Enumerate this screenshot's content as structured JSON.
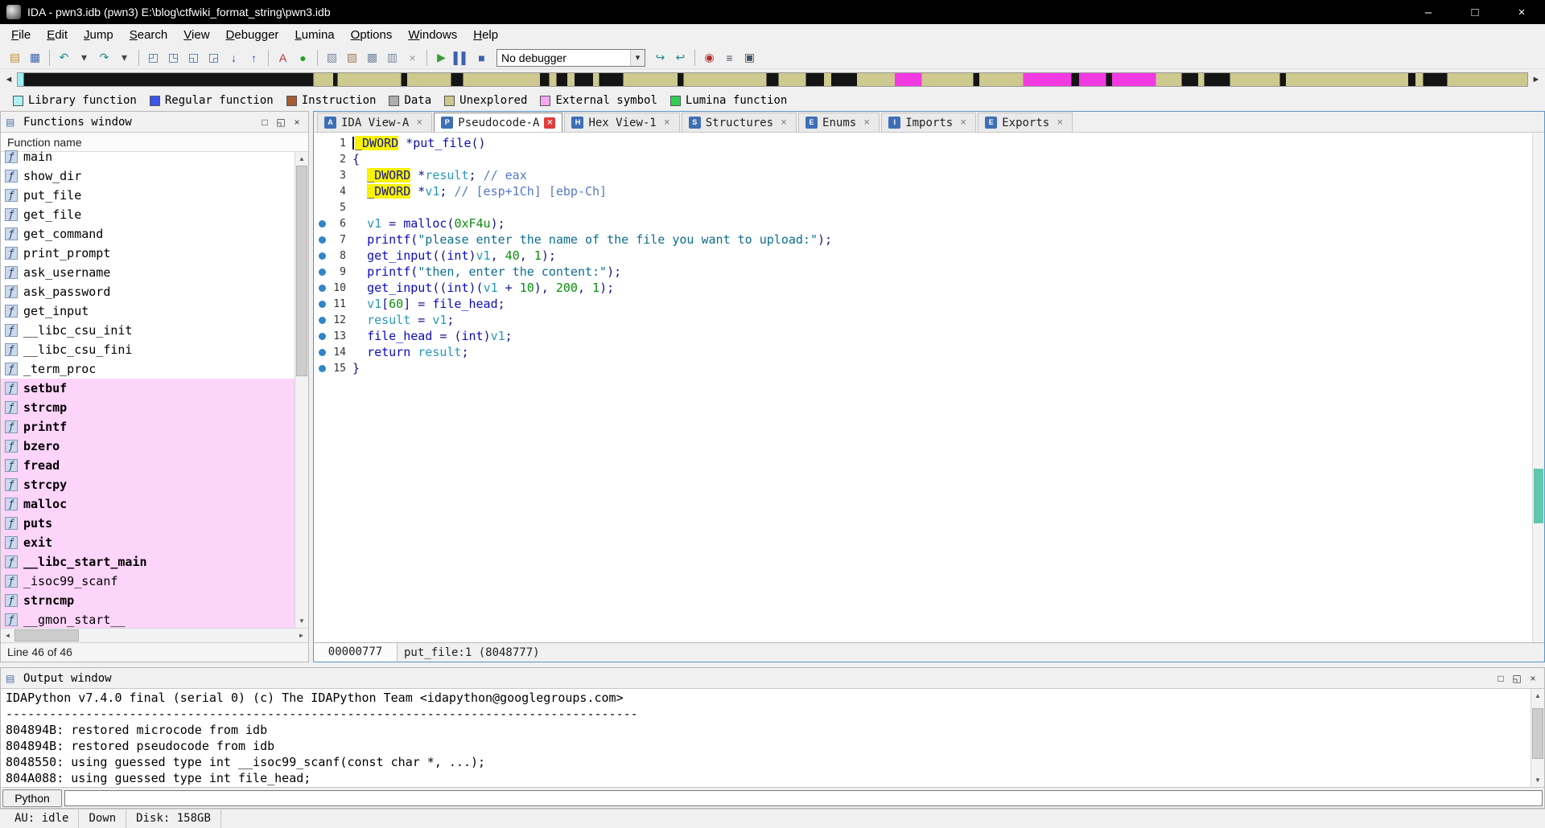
{
  "window": {
    "title": "IDA - pwn3.idb (pwn3) E:\\blog\\ctfwiki_format_string\\pwn3.idb"
  },
  "glyphs": {
    "minimize": "–",
    "maximize": "□",
    "close": "×",
    "close_dark": "×",
    "restore": "□",
    "float": "◱",
    "panel": "▤",
    "up": "▲",
    "down": "▼",
    "left": "◄",
    "right": "►"
  },
  "menu": {
    "items": [
      "File",
      "Edit",
      "Jump",
      "Search",
      "View",
      "Debugger",
      "Lumina",
      "Options",
      "Windows",
      "Help"
    ]
  },
  "toolbar": {
    "items": [
      {
        "kind": "icon",
        "name": "open-database-icon",
        "glyph": "▤",
        "color": "#c09030"
      },
      {
        "kind": "icon",
        "name": "save-database-icon",
        "glyph": "▦",
        "color": "#3a62b0"
      },
      {
        "kind": "sep"
      },
      {
        "kind": "icon",
        "name": "navigate-back-icon",
        "glyph": "↶",
        "color": "#1a8a8a"
      },
      {
        "kind": "icon",
        "name": "back-history-dropdown-icon",
        "glyph": "▾",
        "color": "#444444"
      },
      {
        "kind": "icon",
        "name": "navigate-forward-icon",
        "glyph": "↷",
        "color": "#1a8a8a"
      },
      {
        "kind": "icon",
        "name": "forward-history-dropdown-icon",
        "glyph": "▾",
        "color": "#444444"
      },
      {
        "kind": "sep"
      },
      {
        "kind": "icon",
        "name": "jump-address-icon",
        "glyph": "◰",
        "color": "#3a6ea5"
      },
      {
        "kind": "icon",
        "name": "jump-name-icon",
        "glyph": "◳",
        "color": "#3a6ea5"
      },
      {
        "kind": "icon",
        "name": "jump-segment-icon",
        "glyph": "◱",
        "color": "#3a6ea5"
      },
      {
        "kind": "icon",
        "name": "jump-problem-icon",
        "glyph": "◲",
        "color": "#3a6ea5"
      },
      {
        "kind": "icon",
        "name": "jump-down-icon",
        "glyph": "↓",
        "color": "#2a4ac0"
      },
      {
        "kind": "icon",
        "name": "jump-up-icon",
        "glyph": "↑",
        "color": "#2a4ac0"
      },
      {
        "kind": "sep"
      },
      {
        "kind": "icon",
        "name": "text-search-icon",
        "glyph": "A",
        "color": "#c03030"
      },
      {
        "kind": "icon",
        "name": "reanalyze-icon",
        "glyph": "●",
        "color": "#2aa02a"
      },
      {
        "kind": "sep"
      },
      {
        "kind": "icon",
        "name": "flow-chart-icon",
        "glyph": "▧",
        "color": "#7a8aa0"
      },
      {
        "kind": "icon",
        "name": "call-graph-icon",
        "glyph": "▨",
        "color": "#a08060"
      },
      {
        "kind": "icon",
        "name": "xrefs-graph-icon",
        "glyph": "▩",
        "color": "#7a8aa0"
      },
      {
        "kind": "icon",
        "name": "custom-graph-icon",
        "glyph": "▥",
        "color": "#7a8aa0"
      },
      {
        "kind": "icon",
        "name": "cancel-analysis-icon",
        "glyph": "×",
        "color": "#999999"
      },
      {
        "kind": "sep"
      },
      {
        "kind": "icon",
        "name": "debugger-start-icon",
        "glyph": "▶",
        "color": "#3c9a3c"
      },
      {
        "kind": "icon",
        "name": "debugger-pause-icon",
        "glyph": "▌▌",
        "color": "#3a62b0"
      },
      {
        "kind": "icon",
        "name": "debugger-stop-icon",
        "glyph": "■",
        "color": "#3a62b0"
      },
      {
        "kind": "combo",
        "name": "debugger-selector",
        "value": "No debugger",
        "arrow": "▾"
      },
      {
        "kind": "icon",
        "name": "attach-process-icon",
        "glyph": "↪",
        "color": "#1a8a8a"
      },
      {
        "kind": "icon",
        "name": "detach-process-icon",
        "glyph": "↩",
        "color": "#1a8a8a"
      },
      {
        "kind": "sep"
      },
      {
        "kind": "icon",
        "name": "breakpoint-list-icon",
        "glyph": "◉",
        "color": "#b03030"
      },
      {
        "kind": "icon",
        "name": "watch-list-icon",
        "glyph": "≡",
        "color": "#445566"
      },
      {
        "kind": "icon",
        "name": "trace-window-icon",
        "glyph": "▣",
        "color": "#445566"
      }
    ]
  },
  "legend": {
    "items": [
      {
        "label": "Library function",
        "color": "#aef2f2"
      },
      {
        "label": "Regular function",
        "color": "#3a56e8"
      },
      {
        "label": "Instruction",
        "color": "#a85a32"
      },
      {
        "label": "Data",
        "color": "#adadad"
      },
      {
        "label": "Unexplored",
        "color": "#cdc98f"
      },
      {
        "label": "External symbol",
        "color": "#f7a6f0"
      },
      {
        "label": "Lumina function",
        "color": "#2fcf4f"
      }
    ]
  },
  "functions_window": {
    "title": "Functions window",
    "column_header": "Function name",
    "status": "Line 46 of 46",
    "icon_glyph": "ƒ",
    "items": [
      {
        "name": "main",
        "lib": false,
        "bold": false
      },
      {
        "name": "show_dir",
        "lib": false,
        "bold": false
      },
      {
        "name": "put_file",
        "lib": false,
        "bold": false
      },
      {
        "name": "get_file",
        "lib": false,
        "bold": false
      },
      {
        "name": "get_command",
        "lib": false,
        "bold": false
      },
      {
        "name": "print_prompt",
        "lib": false,
        "bold": false
      },
      {
        "name": "ask_username",
        "lib": false,
        "bold": false
      },
      {
        "name": "ask_password",
        "lib": false,
        "bold": false
      },
      {
        "name": "get_input",
        "lib": false,
        "bold": false
      },
      {
        "name": "__libc_csu_init",
        "lib": false,
        "bold": false
      },
      {
        "name": "__libc_csu_fini",
        "lib": false,
        "bold": false
      },
      {
        "name": "_term_proc",
        "lib": false,
        "bold": false
      },
      {
        "name": "setbuf",
        "lib": true,
        "bold": true
      },
      {
        "name": "strcmp",
        "lib": true,
        "bold": true
      },
      {
        "name": "printf",
        "lib": true,
        "bold": true
      },
      {
        "name": "bzero",
        "lib": true,
        "bold": true
      },
      {
        "name": "fread",
        "lib": true,
        "bold": true
      },
      {
        "name": "strcpy",
        "lib": true,
        "bold": true
      },
      {
        "name": "malloc",
        "lib": true,
        "bold": true
      },
      {
        "name": "puts",
        "lib": true,
        "bold": true
      },
      {
        "name": "exit",
        "lib": true,
        "bold": true
      },
      {
        "name": "__libc_start_main",
        "lib": true,
        "bold": true
      },
      {
        "name": "_isoc99_scanf",
        "lib": true,
        "bold": false
      },
      {
        "name": "strncmp",
        "lib": true,
        "bold": true
      },
      {
        "name": "__gmon_start__",
        "lib": true,
        "bold": false
      }
    ]
  },
  "tabs": {
    "close_glyph": "×",
    "items": [
      {
        "label": "IDA View-A",
        "letter": "A",
        "active": false
      },
      {
        "label": "Pseudocode-A",
        "letter": "P",
        "active": true
      },
      {
        "label": "Hex View-1",
        "letter": "H",
        "active": false
      },
      {
        "label": "Structures",
        "letter": "S",
        "active": false
      },
      {
        "label": "Enums",
        "letter": "E",
        "active": false
      },
      {
        "label": "Imports",
        "letter": "I",
        "active": false
      },
      {
        "label": "Exports",
        "letter": "E",
        "active": false
      }
    ]
  },
  "pseudocode": {
    "status_address": "00000777",
    "status_position": "put_file:1 (8048777)",
    "lines": [
      {
        "n": 1,
        "dot": false,
        "caret": true,
        "tokens": [
          [
            "_DWORD",
            "hl"
          ],
          [
            " *",
            "pl"
          ],
          [
            "put_file",
            "fn"
          ],
          [
            "()",
            "pl"
          ]
        ]
      },
      {
        "n": 2,
        "dot": false,
        "tokens": [
          [
            "{",
            "pl"
          ]
        ]
      },
      {
        "n": 3,
        "dot": false,
        "tokens": [
          [
            "  ",
            "pl"
          ],
          [
            "_DWORD",
            "hl"
          ],
          [
            " *",
            "pl"
          ],
          [
            "result",
            "var"
          ],
          [
            "; ",
            "pl"
          ],
          [
            "// eax",
            "cmt"
          ]
        ]
      },
      {
        "n": 4,
        "dot": false,
        "tokens": [
          [
            "  ",
            "pl"
          ],
          [
            "_DWORD",
            "hl"
          ],
          [
            " *",
            "pl"
          ],
          [
            "v1",
            "var"
          ],
          [
            "; ",
            "pl"
          ],
          [
            "// [esp+1Ch] [ebp-Ch]",
            "cmt"
          ]
        ]
      },
      {
        "n": 5,
        "dot": false,
        "tokens": []
      },
      {
        "n": 6,
        "dot": true,
        "tokens": [
          [
            "  ",
            "pl"
          ],
          [
            "v1",
            "var"
          ],
          [
            " = ",
            "pl"
          ],
          [
            "malloc",
            "fn"
          ],
          [
            "(",
            "pl"
          ],
          [
            "0xF4u",
            "num"
          ],
          [
            ");",
            "pl"
          ]
        ]
      },
      {
        "n": 7,
        "dot": true,
        "tokens": [
          [
            "  ",
            "pl"
          ],
          [
            "printf",
            "fn"
          ],
          [
            "(",
            "pl"
          ],
          [
            "\"please enter the name of the file you want to upload:\"",
            "str"
          ],
          [
            ");",
            "pl"
          ]
        ]
      },
      {
        "n": 8,
        "dot": true,
        "tokens": [
          [
            "  ",
            "pl"
          ],
          [
            "get_input",
            "fn"
          ],
          [
            "((",
            "pl"
          ],
          [
            "int",
            "kw"
          ],
          [
            ")",
            "pl"
          ],
          [
            "v1",
            "var"
          ],
          [
            ", ",
            "pl"
          ],
          [
            "40",
            "num"
          ],
          [
            ", ",
            "pl"
          ],
          [
            "1",
            "num"
          ],
          [
            ");",
            "pl"
          ]
        ]
      },
      {
        "n": 9,
        "dot": true,
        "tokens": [
          [
            "  ",
            "pl"
          ],
          [
            "printf",
            "fn"
          ],
          [
            "(",
            "pl"
          ],
          [
            "\"then, enter the content:\"",
            "str"
          ],
          [
            ");",
            "pl"
          ]
        ]
      },
      {
        "n": 10,
        "dot": true,
        "tokens": [
          [
            "  ",
            "pl"
          ],
          [
            "get_input",
            "fn"
          ],
          [
            "((",
            "pl"
          ],
          [
            "int",
            "kw"
          ],
          [
            ")(",
            "pl"
          ],
          [
            "v1",
            "var"
          ],
          [
            " + ",
            "pl"
          ],
          [
            "10",
            "num"
          ],
          [
            "), ",
            "pl"
          ],
          [
            "200",
            "num"
          ],
          [
            ", ",
            "pl"
          ],
          [
            "1",
            "num"
          ],
          [
            ");",
            "pl"
          ]
        ]
      },
      {
        "n": 11,
        "dot": true,
        "tokens": [
          [
            "  ",
            "pl"
          ],
          [
            "v1",
            "var"
          ],
          [
            "[",
            "pl"
          ],
          [
            "60",
            "num"
          ],
          [
            "] = ",
            "pl"
          ],
          [
            "file_head",
            "glob"
          ],
          [
            ";",
            "pl"
          ]
        ]
      },
      {
        "n": 12,
        "dot": true,
        "tokens": [
          [
            "  ",
            "pl"
          ],
          [
            "result",
            "var"
          ],
          [
            " = ",
            "pl"
          ],
          [
            "v1",
            "var"
          ],
          [
            ";",
            "pl"
          ]
        ]
      },
      {
        "n": 13,
        "dot": true,
        "tokens": [
          [
            "  ",
            "pl"
          ],
          [
            "file_head",
            "glob"
          ],
          [
            " = (",
            "pl"
          ],
          [
            "int",
            "kw"
          ],
          [
            ")",
            "pl"
          ],
          [
            "v1",
            "var"
          ],
          [
            ";",
            "pl"
          ]
        ]
      },
      {
        "n": 14,
        "dot": true,
        "tokens": [
          [
            "  ",
            "pl"
          ],
          [
            "return",
            "kw"
          ],
          [
            " ",
            "pl"
          ],
          [
            "result",
            "var"
          ],
          [
            ";",
            "pl"
          ]
        ]
      },
      {
        "n": 15,
        "dot": true,
        "tokens": [
          [
            "}",
            "pl"
          ]
        ]
      }
    ]
  },
  "output_window": {
    "title": "Output window",
    "python_button": "Python",
    "lines": [
      "IDAPython v7.4.0 final (serial 0) (c) The IDAPython Team <idapython@googlegroups.com>",
      "---------------------------------------------------------------------------------------",
      "804894B: restored microcode from idb",
      "804894B: restored pseudocode from idb",
      "8048550: using guessed type int __isoc99_scanf(const char *, ...);",
      "804A088: using guessed type int file_head;"
    ]
  },
  "status_bar": {
    "au": "AU: idle",
    "down": "Down",
    "disk": "Disk: 158GB"
  }
}
